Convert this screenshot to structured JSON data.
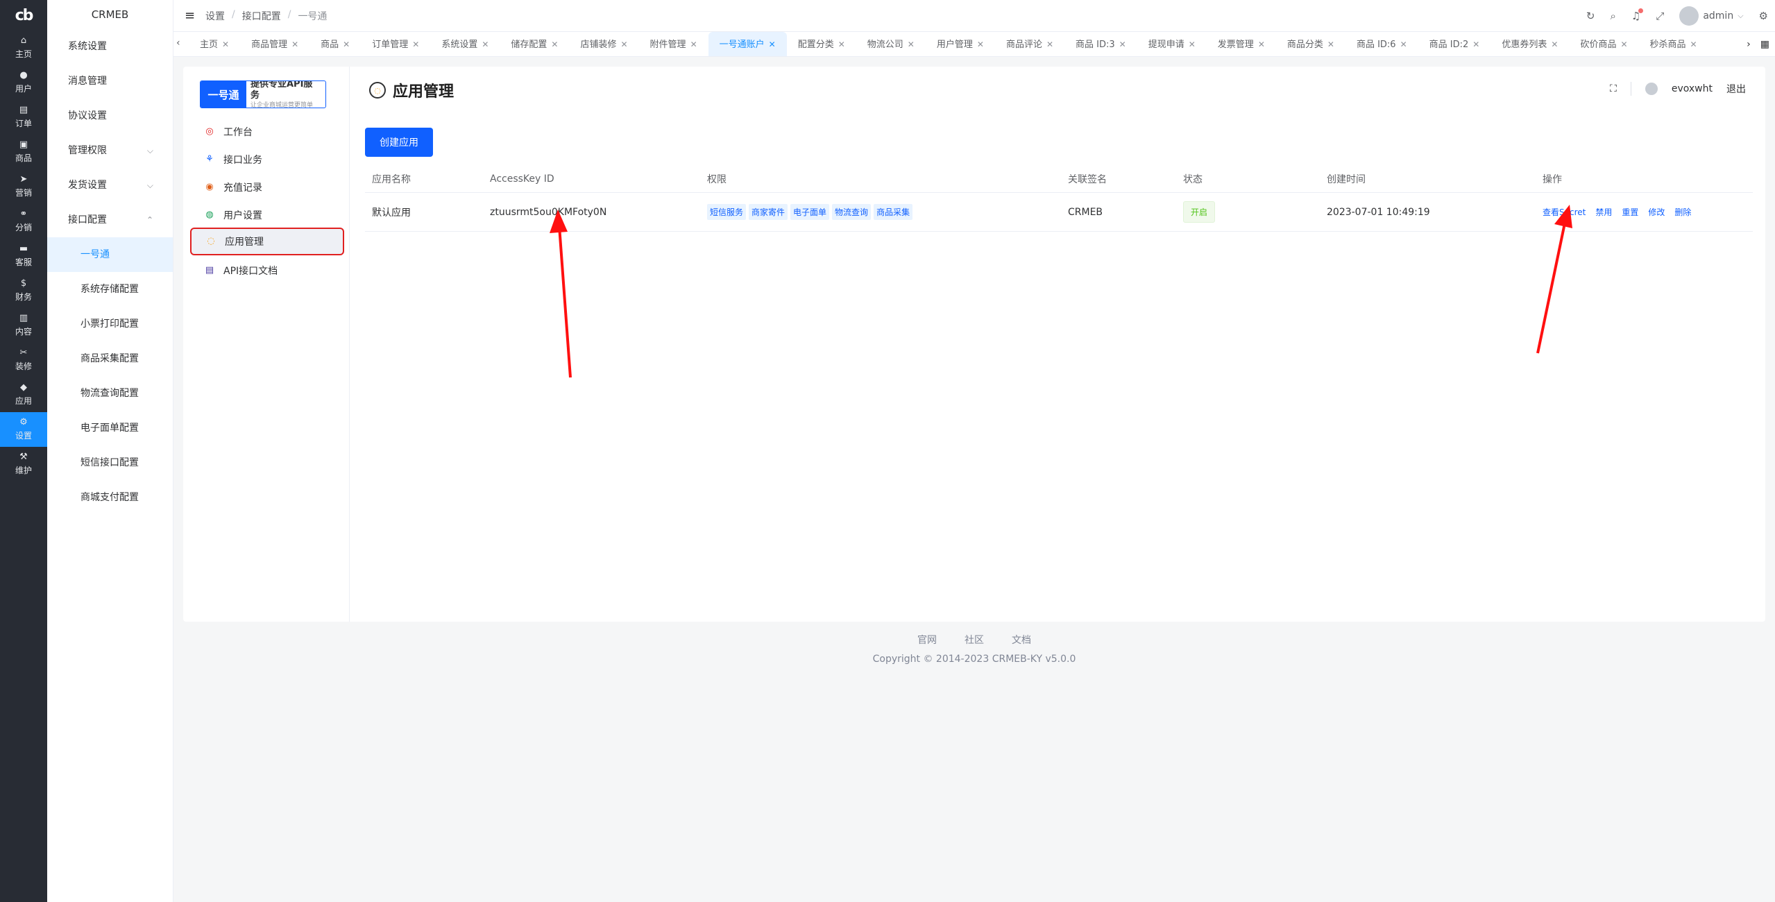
{
  "rail": {
    "logo": "cb",
    "items": [
      {
        "label": "主页",
        "icon": "home-icon",
        "glyph": "⌂"
      },
      {
        "label": "用户",
        "icon": "user-icon",
        "glyph": "●"
      },
      {
        "label": "订单",
        "icon": "cart-icon",
        "glyph": "▤"
      },
      {
        "label": "商品",
        "icon": "bag-icon",
        "glyph": "▣"
      },
      {
        "label": "营销",
        "icon": "send-icon",
        "glyph": "➤"
      },
      {
        "label": "分销",
        "icon": "share-icon",
        "glyph": "⚭"
      },
      {
        "label": "客服",
        "icon": "chat-icon",
        "glyph": "▬"
      },
      {
        "label": "财务",
        "icon": "dollar-icon",
        "glyph": "$"
      },
      {
        "label": "内容",
        "icon": "book-icon",
        "glyph": "▥"
      },
      {
        "label": "装修",
        "icon": "tools-icon",
        "glyph": "✂"
      },
      {
        "label": "应用",
        "icon": "cube-icon",
        "glyph": "◆"
      },
      {
        "label": "设置",
        "icon": "gear-icon",
        "glyph": "⚙"
      },
      {
        "label": "维护",
        "icon": "hammer-icon",
        "glyph": "⚒"
      }
    ],
    "active_index": 11
  },
  "submenu": {
    "title": "CRMEB",
    "items": [
      {
        "label": "系统设置"
      },
      {
        "label": "消息管理"
      },
      {
        "label": "协议设置"
      },
      {
        "label": "管理权限",
        "chevron": "⌵"
      },
      {
        "label": "发货设置",
        "chevron": "⌵"
      },
      {
        "label": "接口配置",
        "chevron": "⌃"
      }
    ],
    "children": [
      "一号通",
      "系统存储配置",
      "小票打印配置",
      "商品采集配置",
      "物流查询配置",
      "电子面单配置",
      "短信接口配置",
      "商城支付配置"
    ]
  },
  "header": {
    "menu_glyph": "≡",
    "breadcrumb": [
      "设置",
      "接口配置",
      "一号通"
    ],
    "sep": "/",
    "refresh_glyph": "↻",
    "search_glyph": "⌕",
    "bell_glyph": "♫",
    "fullscreen_glyph": "⤢",
    "username": "admin",
    "caret": "⌵",
    "settings_glyph": "⚙"
  },
  "tabs": {
    "left_arrow": "‹",
    "right_arrow": "›",
    "grid_glyph": "▦",
    "close": "✕",
    "items": [
      "主页",
      "商品管理",
      "商品",
      "订单管理",
      "系统设置",
      "储存配置",
      "店铺装修",
      "附件管理",
      "一号通账户",
      "配置分类",
      "物流公司",
      "用户管理",
      "商品评论",
      "商品 ID:3",
      "提现申请",
      "发票管理",
      "商品分类",
      "商品 ID:6",
      "商品 ID:2",
      "优惠券列表",
      "砍价商品",
      "秒杀商品"
    ],
    "active_index": 8
  },
  "brand": {
    "left": "一号通",
    "title": "提供专业API服务",
    "subtitle": "让企业商城运营更简单"
  },
  "inner_nav": [
    {
      "label": "工作台",
      "glyph": "◎",
      "color": "#e02020"
    },
    {
      "label": "接口业务",
      "glyph": "⚘",
      "color": "#1060ff"
    },
    {
      "label": "充值记录",
      "glyph": "◉",
      "color": "#e0601a"
    },
    {
      "label": "用户设置",
      "glyph": "◍",
      "color": "#1aa05a"
    },
    {
      "label": "应用管理",
      "glyph": "◌",
      "color": "#f5a623"
    },
    {
      "label": "API接口文档",
      "glyph": "▤",
      "color": "#4a3aa0"
    }
  ],
  "inner_nav_active": 4,
  "page": {
    "title": "应用管理",
    "icon_glyph": "◌",
    "fullscreen_glyph": "⛶",
    "account": "evoxwht",
    "logout": "退出",
    "create_button": "创建应用"
  },
  "table": {
    "headers": [
      "应用名称",
      "AccessKey ID",
      "权限",
      "关联签名",
      "状态",
      "创建时间",
      "操作"
    ],
    "rows": [
      {
        "name": "默认应用",
        "access_key": "ztuusrmt5ou0KMFoty0N",
        "permissions": [
          "短信服务",
          "商家寄件",
          "电子面单",
          "物流查询",
          "商品采集"
        ],
        "signature": "CRMEB",
        "status": "开启",
        "created": "2023-07-01 10:49:19",
        "actions": [
          "查看Secret",
          "禁用",
          "重置",
          "修改",
          "删除"
        ]
      }
    ]
  },
  "footer": {
    "links": [
      "官网",
      "社区",
      "文档"
    ],
    "copyright": "Copyright © 2014-2023 CRMEB-KY v5.0.0"
  },
  "colors": {
    "primary": "#1060ff",
    "rail_bg": "#282c34",
    "rail_active": "#1890ff",
    "highlight_border": "#e02020",
    "arrow": "#ff1010",
    "status_green": "#52c41a"
  }
}
